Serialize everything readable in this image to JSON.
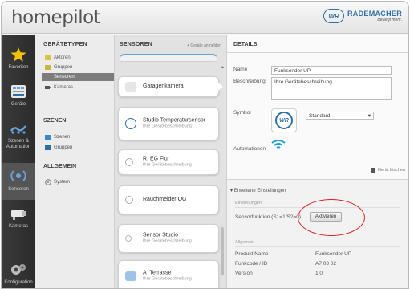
{
  "header": {
    "logo": "homepilot",
    "brand_name": "RADEMACHER",
    "brand_claim": "Bewegt mehr.",
    "brand_badge": "WR"
  },
  "nav": [
    {
      "label": "Favoriten",
      "icon": "star-icon"
    },
    {
      "label": "Geräte",
      "icon": "devices-icon"
    },
    {
      "label": "Szenen & Automation",
      "icon": "scenes-icon"
    },
    {
      "label": "Sensoren",
      "icon": "sensor-icon"
    },
    {
      "label": "Kameras",
      "icon": "camera-icon"
    },
    {
      "label": "Konfiguration",
      "icon": "gears-icon"
    }
  ],
  "categories": {
    "title": "GERÄTETYPEN",
    "items": [
      "Aktoren",
      "Gruppen",
      "Sensoren",
      "Kameras"
    ],
    "scenes_title": "SZENEN",
    "scenes_items": [
      "Szenen",
      "Gruppen"
    ],
    "general_title": "ALLGEMEIN",
    "general_items": [
      "System"
    ]
  },
  "sensors": {
    "title": "SENSOREN",
    "add_label": "+ Geräte anmelden",
    "cards": [
      {
        "name": "Garagenkamera",
        "sub": ""
      },
      {
        "name": "Studio Temperatursensor",
        "sub": "Ihre Gerätebeschreibung"
      },
      {
        "name": "R. EG Flur",
        "sub": "Ihre Gerätebeschreibung"
      },
      {
        "name": "Rauchmelder OG",
        "sub": ""
      },
      {
        "name": "Sensor Studio",
        "sub": "Ihre Gerätebeschreibung"
      },
      {
        "name": "A_Terrasse",
        "sub": "Ihre Gerätebeschreibung"
      }
    ]
  },
  "details": {
    "title": "DETAILS",
    "name_label": "Name",
    "name_value": "Funksender UP",
    "desc_label": "Beschreibung",
    "desc_value": "Ihre Gerätebeschreibung",
    "symbol_label": "Symbol",
    "symbol_select": "Standard",
    "automation_label": "Automationen",
    "delete_label": "Gerät löschen",
    "advanced_title": "Erweiterte Einstellungen",
    "settings_heading": "Einstellungen",
    "sensor_function_label": "Sensorfunktion (S1=1/S2=0)",
    "activate_button": "Aktivieren",
    "general_heading": "Allgemein",
    "rows": [
      {
        "label": "Produkt Name",
        "value": "Funksender UP"
      },
      {
        "label": "Funkcode / ID",
        "value": "A7 03 02"
      },
      {
        "label": "Version",
        "value": "1.0"
      }
    ]
  },
  "colors": {
    "accent": "#2f6fa8",
    "highlight_circle": "#d82020",
    "nav_bg": "#333333",
    "star": "#f2c200"
  }
}
